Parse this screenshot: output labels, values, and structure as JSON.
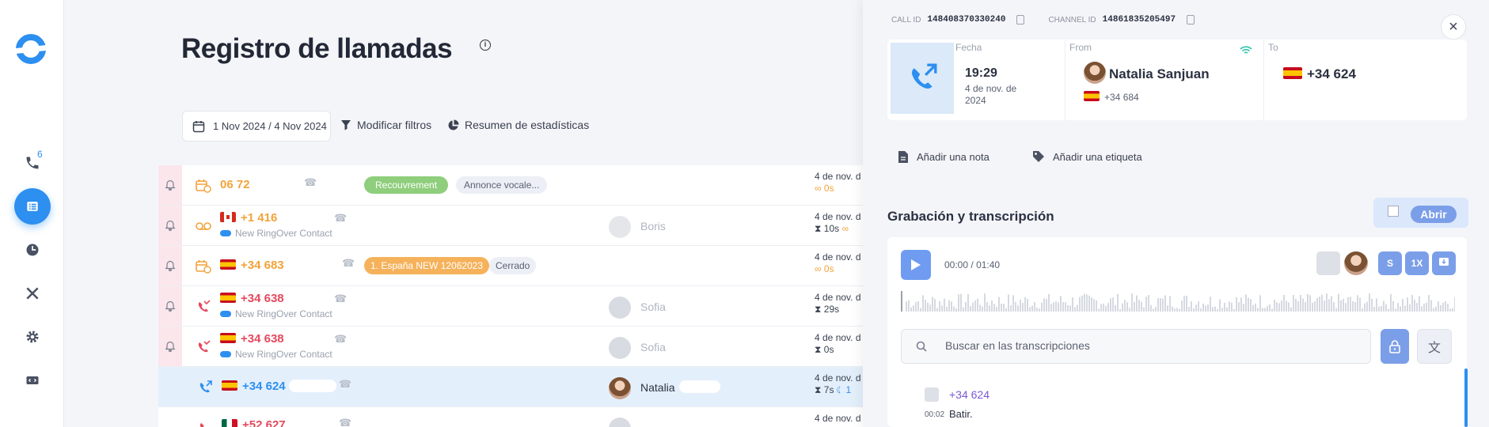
{
  "sidebar": {
    "badge_count": "6",
    "items": [
      {
        "icon": "phone-icon"
      },
      {
        "icon": "list-icon",
        "active": true
      },
      {
        "icon": "clock-icon"
      },
      {
        "icon": "tools-icon"
      },
      {
        "icon": "gear-icon"
      },
      {
        "icon": "code-icon"
      }
    ]
  },
  "main": {
    "title": "Registro de llamadas",
    "date_range": "1 Nov 2024 / 4 Nov 2024",
    "modify_filters": "Modificar filtros",
    "stats_summary": "Resumen de estadísticas"
  },
  "calls": [
    {
      "number": "06 72",
      "color": "orange",
      "tags": [
        "Recouvrement",
        "Annonce vocale..."
      ],
      "date": "4 de nov. d",
      "duration": "0s"
    },
    {
      "number": "+1 416",
      "color": "orange",
      "flag": "ca",
      "sub": "New RingOver Contact",
      "agent": "Boris",
      "date": "4 de nov. d",
      "duration": "10s"
    },
    {
      "number": "+34 683",
      "color": "orange",
      "flag": "es",
      "tags": [
        "1. España NEW 12062023",
        "Cerrado"
      ],
      "date": "4 de nov. d",
      "duration": "0s"
    },
    {
      "number": "+34 638",
      "color": "red",
      "flag": "es",
      "sub": "New RingOver Contact",
      "agent": "Sofia",
      "date": "4 de nov. d",
      "duration": "29s"
    },
    {
      "number": "+34 638",
      "color": "red",
      "flag": "es",
      "sub": "New RingOver Contact",
      "agent": "Sofia",
      "date": "4 de nov. d",
      "duration": "0s"
    },
    {
      "number": "+34 624",
      "color": "blue",
      "flag": "es",
      "agent": "Natalia",
      "date": "4 de nov. d",
      "duration": "7s",
      "extra": "1"
    },
    {
      "number": "+52 627",
      "color": "red",
      "flag": "mx",
      "date": "4 de nov. d"
    }
  ],
  "panel": {
    "call_id_label": "CALL ID",
    "call_id": "148408370330240",
    "channel_id_label": "CHANNEL ID",
    "channel_id": "14861835205497",
    "fecha_label": "Fecha",
    "time": "19:29",
    "date": "4 de nov. de 2024",
    "from_label": "From",
    "from_name": "Natalia Sanjuan",
    "from_number": "+34 684",
    "to_label": "To",
    "to_number": "+34 624",
    "add_note": "Añadir una nota",
    "add_tag": "Añadir una etiqueta",
    "recording_title": "Grabación y transcripción",
    "open_label": "Abrir",
    "elapsed": "00:00",
    "separator": "/",
    "total": "01:40",
    "speaker_label": "S",
    "speed_label": "1X",
    "search_placeholder": "Buscar en las transcripciones",
    "transcript": [
      {
        "speaker": "+34 624",
        "time": "00:02",
        "text": "Batir."
      }
    ]
  },
  "colors": {
    "accent": "#2d8ff0",
    "missed": "#e5495d",
    "voicemail": "#f2a33a",
    "button": "#7b9ee8"
  }
}
